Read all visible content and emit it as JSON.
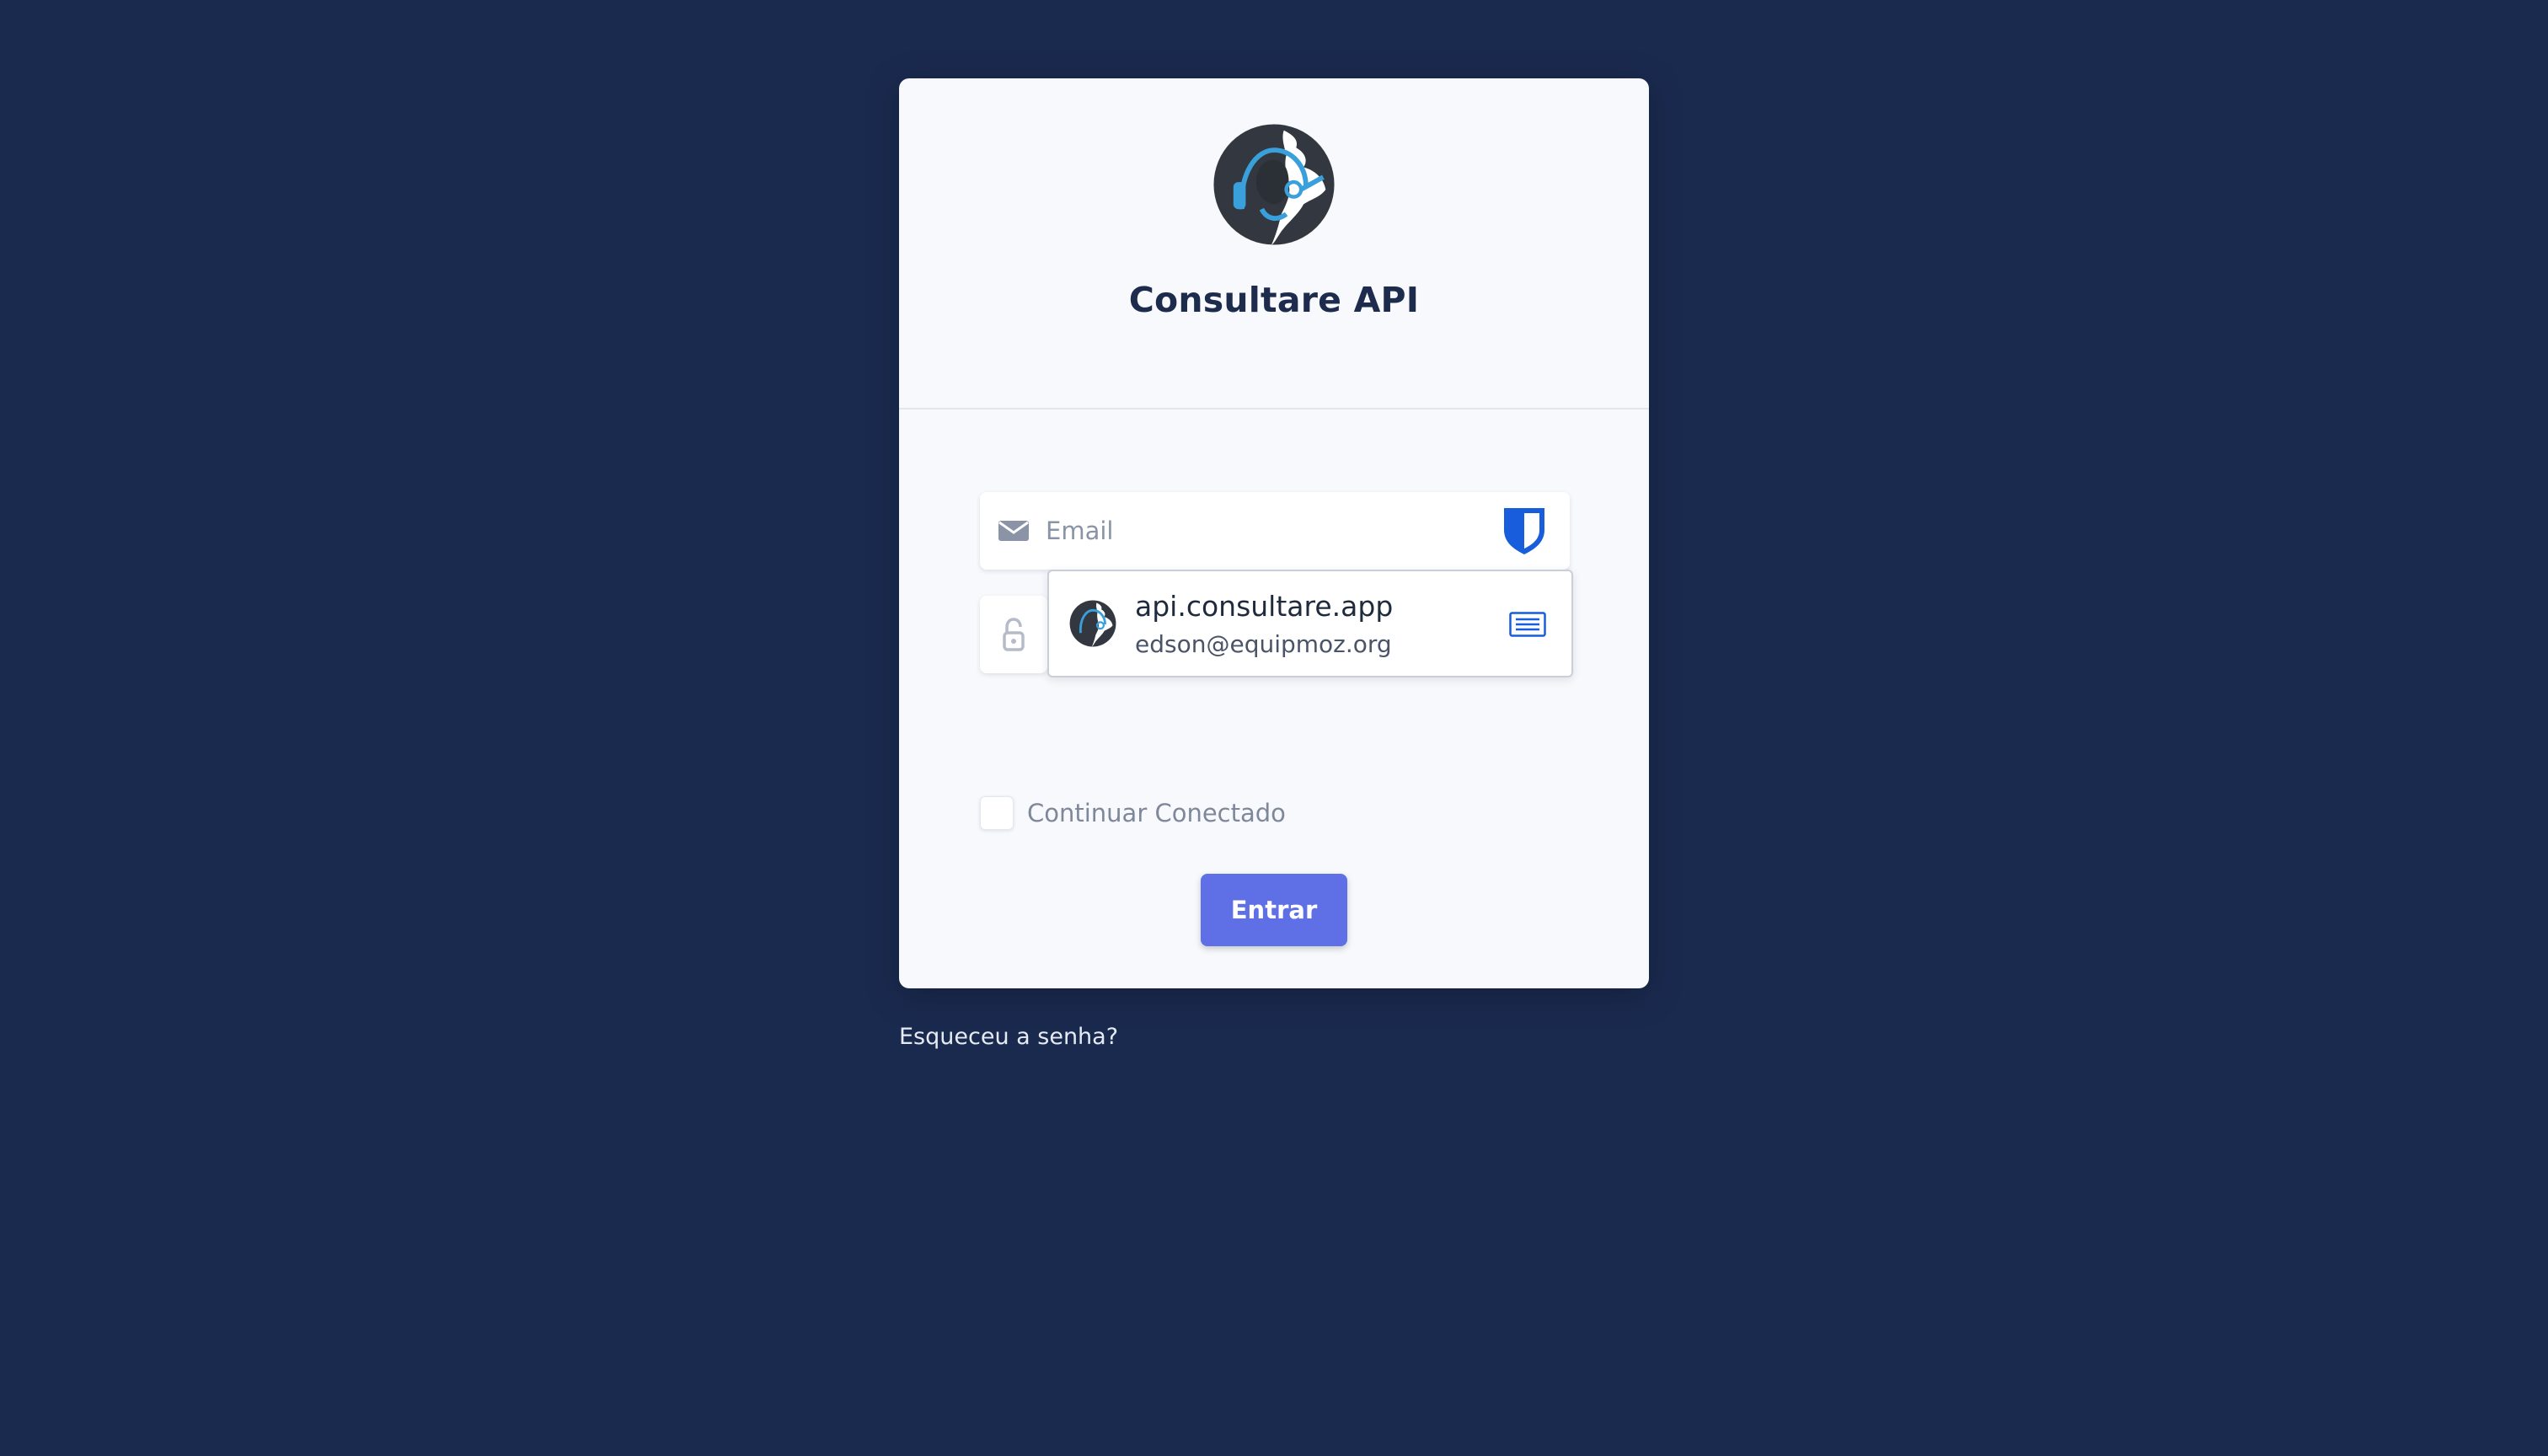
{
  "colors": {
    "background": "#1a2a4f",
    "card": "#f7f9fc",
    "primary_button": "#5f6fe6",
    "title_text": "#1d2b4d",
    "logo_accent": "#39a0dc"
  },
  "app": {
    "title": "Consultare API",
    "logo_icon": "globe-headset-logo"
  },
  "login_form": {
    "email_placeholder": "Email",
    "email_icon": "envelope-icon",
    "password_icon": "lock-icon",
    "remember_label": "Continuar Conectado",
    "submit_label": "Entrar"
  },
  "autofill_suggestion": {
    "site": "api.consultare.app",
    "username": "edson@equipmoz.org",
    "extension_icon": "bitwarden-shield-icon",
    "fill_icon": "fill-card-icon"
  },
  "footer": {
    "forgot_password_label": "Esqueceu a senha?"
  }
}
